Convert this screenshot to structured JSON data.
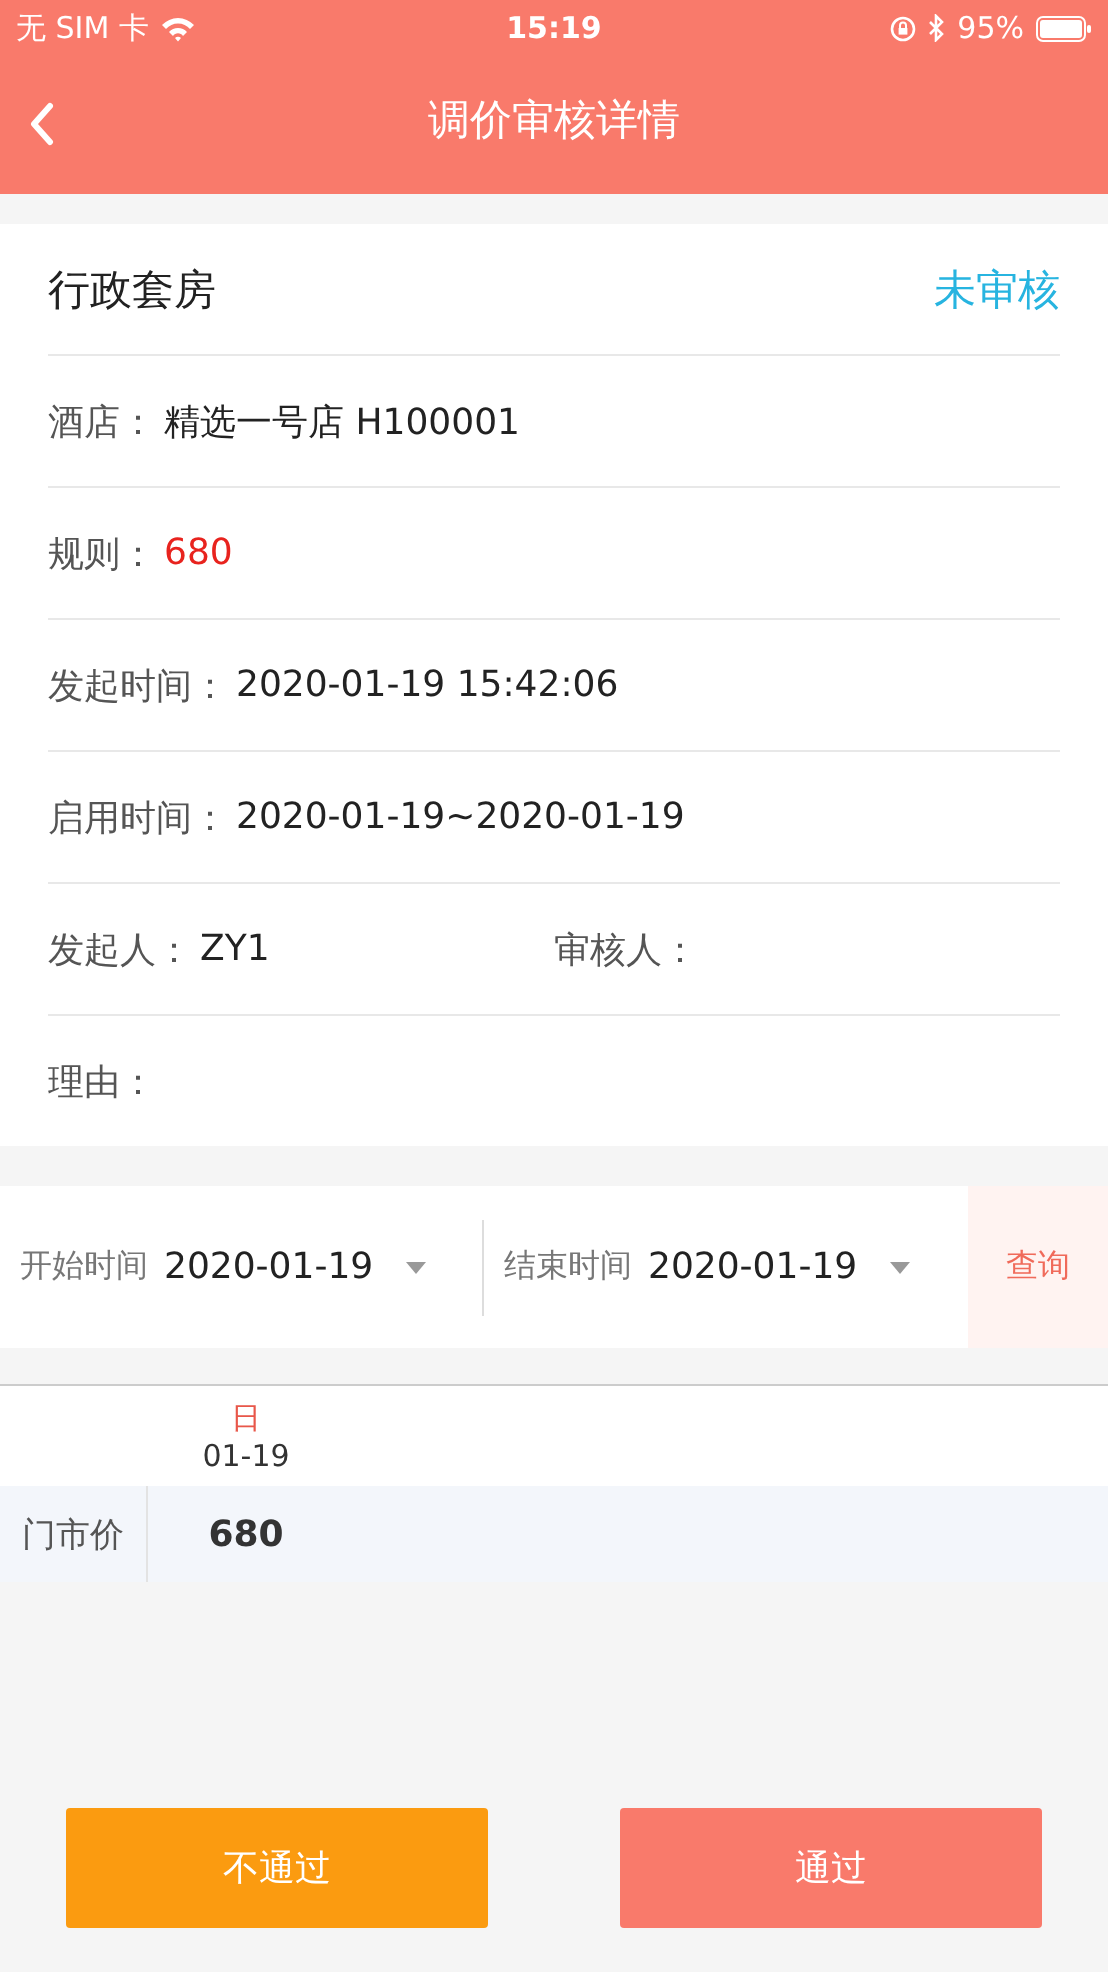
{
  "status_bar": {
    "carrier": "无 SIM 卡",
    "time": "15:19",
    "battery": "95%"
  },
  "nav": {
    "title": "调价审核详情"
  },
  "detail": {
    "room": "行政套房",
    "status": "未审核",
    "rows": [
      {
        "kind": "text",
        "label": "酒店：",
        "value": "精选一号店 H100001"
      },
      {
        "kind": "price",
        "label": "规则：",
        "value": "680"
      },
      {
        "kind": "text",
        "label": "发起时间：",
        "value": "2020-01-19 15:42:06"
      },
      {
        "kind": "text",
        "label": "启用时间：",
        "value": "2020-01-19~2020-01-19"
      },
      {
        "kind": "pair",
        "label": "发起人：",
        "value": "ZY1",
        "label_2": "审核人："
      },
      {
        "kind": "text",
        "label": "理由："
      }
    ]
  },
  "filter": {
    "start_label": "开始时间",
    "start_value": "2020-01-19",
    "end_label": "结束时间",
    "end_value": "2020-01-19",
    "query": "查询"
  },
  "table": {
    "columns": [
      {
        "weekday": "日",
        "date": "01-19"
      }
    ],
    "rows": [
      {
        "label": "门市价",
        "values": [
          "680"
        ]
      }
    ]
  },
  "actions": [
    {
      "kind": "reject",
      "label": "不通过"
    },
    {
      "kind": "approve",
      "label": "通过"
    }
  ]
}
